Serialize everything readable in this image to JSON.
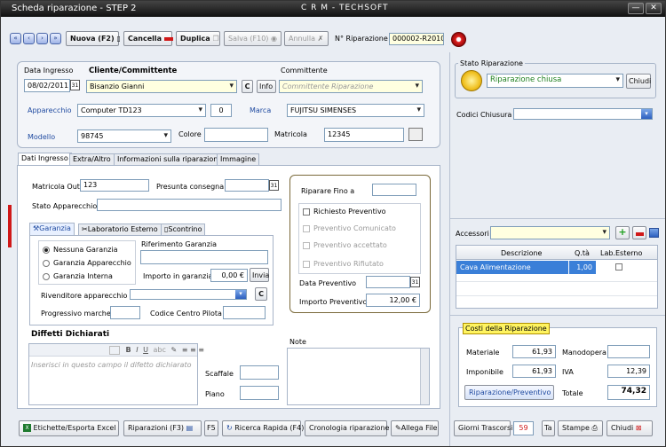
{
  "titlebar": {
    "title": "Scheda riparazione - STEP 2",
    "app": "C R M - TECHSOFT",
    "min": "—",
    "close": "✕"
  },
  "toolbar": {
    "nuova": "Nuova (F2)",
    "cancella": "Cancella",
    "duplica": "Duplica",
    "salva": "Salva (F10)",
    "annulla": "Annulla",
    "nrip_label": "N° Riparazione",
    "nrip_value": "000002-R2010"
  },
  "header": {
    "data_label": "Data Ingresso",
    "data_value": "08/02/2011",
    "cliente_label": "Cliente/Committente",
    "cliente_value": "Bisanzio Gianni",
    "c_btn": "C",
    "info_btn": "Info",
    "committente_label": "Committente",
    "committente_placeholder": "Committente Riparazione",
    "apparecchio_label": "Apparecchio",
    "apparecchio_value": "Computer TD123",
    "qty_value": "0",
    "marca_label": "Marca",
    "marca_value": "FUJITSU SIMENSES",
    "modello_label": "Modello",
    "modello_value": "98745",
    "colore_label": "Colore",
    "colore_value": "",
    "matricola_label": "Matricola",
    "matricola_value": "12345"
  },
  "stato": {
    "title": "Stato Riparazione",
    "value": "Riparazione chiusa",
    "chiudi": "Chiudi",
    "codici_label": "Codici Chiusura",
    "codici_value": ""
  },
  "tabs": [
    "Dati Ingresso",
    "Extra/Altro",
    "Informazioni sulla riparazione",
    "Immagine"
  ],
  "dati": {
    "matricola_out_label": "Matricola Out",
    "matricola_out_value": "123",
    "presunta_label": "Presunta consegna",
    "presunta_value": "",
    "stato_app_label": "Stato Apparecchio",
    "stato_app_value": ""
  },
  "subtabs": [
    "Garanzia",
    "Laboratorio Esterno",
    "Scontrino"
  ],
  "garanzia": {
    "options": [
      "Nessuna Garanzia",
      "Garanzia Apparecchio",
      "Garanzia Interna"
    ],
    "selected": 0,
    "rif_label": "Riferimento Garanzia",
    "rif_value": "",
    "importo_label": "Importo in garanzia",
    "importo_value": "0,00 €",
    "invia": "Invia",
    "rivenditore_label": "Rivenditore apparecchio",
    "rivenditore_value": "",
    "c_btn": "C",
    "prog_label": "Progressivo marche",
    "prog_value": "",
    "centro_label": "Codice Centro Pilota",
    "centro_value": ""
  },
  "preventivo": {
    "riparare_label": "Riparare Fino a",
    "riparare_value": "",
    "checks": [
      "Richiesto Preventivo",
      "Preventivo Comunicato",
      "Preventivo accettato",
      "Preventivo Rifiutato"
    ],
    "data_label": "Data Preventivo",
    "data_value": "",
    "importo_label": "Importo Preventivo",
    "importo_value": "12,00 €"
  },
  "difetti": {
    "title": "Diffetti Dichiarati",
    "placeholder": "Inserisci in questo campo il difetto dichiarato",
    "scaffale_label": "Scaffale",
    "scaffale_value": "",
    "piano_label": "Piano",
    "piano_value": "",
    "note_label": "Note",
    "note_value": ""
  },
  "accessori": {
    "label": "Accessori",
    "value": "",
    "headers": [
      "Descrizione",
      "Q.tà",
      "Lab.Esterno"
    ],
    "rows": [
      {
        "descrizione": "Cava Alimentazione",
        "qta": "1,00",
        "lab": false
      }
    ]
  },
  "costi": {
    "title": "Costi della Riparazione",
    "materiale_label": "Materiale",
    "materiale_value": "61,93",
    "manodopera_label": "Manodopera",
    "manodopera_value": "",
    "imponibile_label": "Imponibile",
    "imponibile_value": "61,93",
    "iva_label": "IVA",
    "iva_value": "12,39",
    "rip_btn": "Riparazione/Preventivo",
    "totale_label": "Totale",
    "totale_value": "74,32"
  },
  "bottom": {
    "etichette": "Etichette/Esporta Excel",
    "riparazioni": "Riparazioni (F3)",
    "f5": "F5",
    "ricerca": "Ricerca Rapida (F4)",
    "cronologia": "Cronologia riparazione",
    "allega": "Allega File",
    "giorni_label": "Giorni Trascorsi",
    "giorni_value": "59",
    "ta": "Ta",
    "stampe": "Stampe",
    "chiudi": "Chiudi"
  },
  "colors": {
    "accent": "#1f4aa0",
    "danger": "#d01818",
    "ok": "#20a020",
    "highlight": "#3a7fd8"
  }
}
